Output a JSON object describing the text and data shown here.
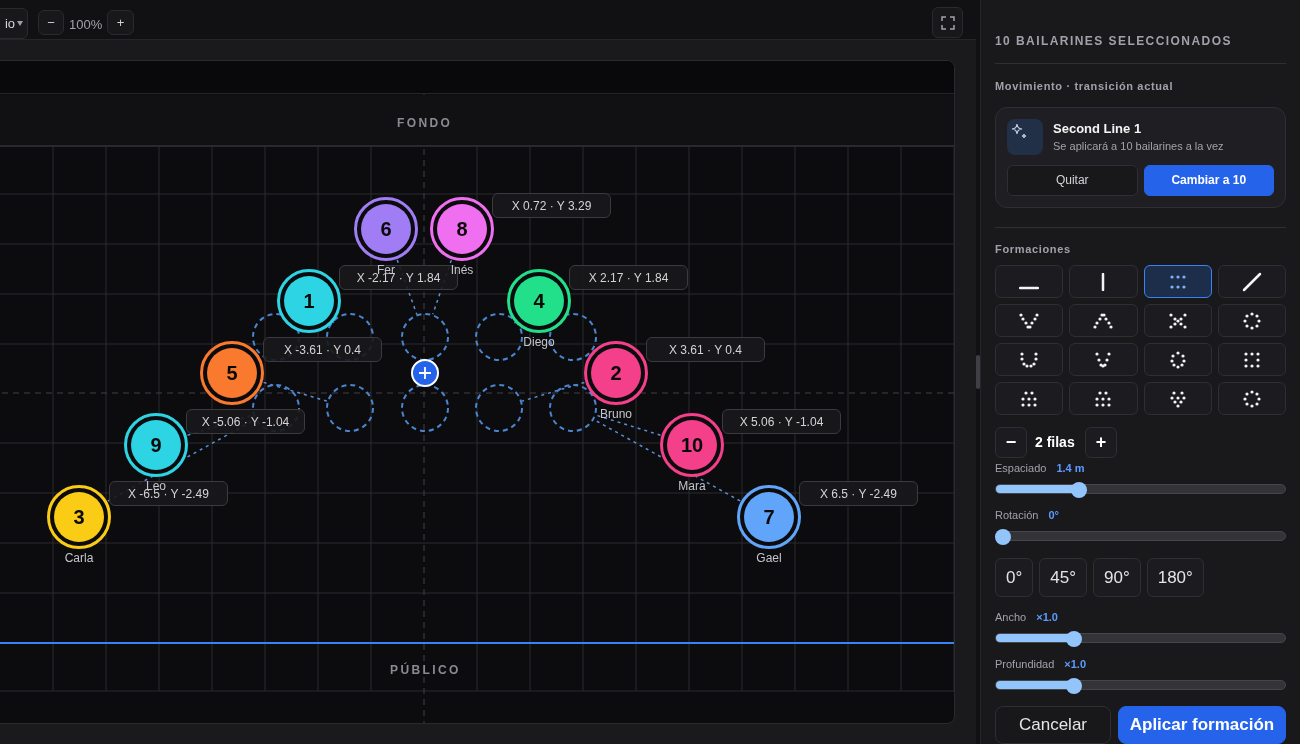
{
  "toolbar": {
    "view_select": "io",
    "zoom_out": "−",
    "zoom": "100%",
    "zoom_in": "+"
  },
  "stage": {
    "back_label": "FONDO",
    "front_label": "PÚBLICO",
    "dancers": [
      {
        "number": "6",
        "name": "Fer",
        "color": "#a07cf5"
      },
      {
        "number": "8",
        "name": "Inés",
        "color": "#f06ef0"
      },
      {
        "number": "1",
        "color": "#2dd4e4"
      },
      {
        "number": "4",
        "name": "Diego",
        "color": "#22e08a"
      },
      {
        "number": "5",
        "color": "#f97a2e"
      },
      {
        "number": "2",
        "name": "Bruno",
        "color": "#f43f8a"
      },
      {
        "number": "9",
        "name": "Leo",
        "color": "#2dd4e4"
      },
      {
        "number": "10",
        "name": "Mara",
        "color": "#f43f8a"
      },
      {
        "number": "3",
        "name": "Carla",
        "color": "#facc15"
      },
      {
        "number": "7",
        "name": "Gael",
        "color": "#60a5fa"
      }
    ],
    "coordinate_labels": [
      "X 0.72 · Y 3.29",
      "X -2.17 · Y 1.84",
      "X 2.17 · Y 1.84",
      "X -3.61 · Y 0.4",
      "X 3.61 · Y 0.4",
      "X -5.06 · Y -1.04",
      "X 5.06 · Y -1.04",
      "X -6.5 · Y -2.49",
      "X 6.5 · Y -2.49"
    ]
  },
  "panel": {
    "title": "10 BAILARINES SELECCIONADOS",
    "movement": {
      "heading": "Movimiento · transición actual",
      "name": "Second Line 1",
      "note": "Se aplicará a 10 bailarines a la vez",
      "buttons": [
        {
          "label": "Quitar",
          "kind": "secondary"
        },
        {
          "label": "Cambiar a 10",
          "kind": "primary"
        }
      ]
    },
    "formations": {
      "heading": "Formaciones",
      "items": [
        {
          "kind": "line-h",
          "selected": false
        },
        {
          "kind": "line-v",
          "selected": false
        },
        {
          "kind": "rows",
          "selected": true
        },
        {
          "kind": "diagonal",
          "selected": false
        },
        {
          "kind": "v",
          "selected": false
        },
        {
          "kind": "caret",
          "selected": false
        },
        {
          "kind": "x",
          "selected": false
        },
        {
          "kind": "circle",
          "selected": false
        },
        {
          "kind": "u",
          "selected": false
        },
        {
          "kind": "smile",
          "selected": false
        },
        {
          "kind": "ring",
          "selected": false
        },
        {
          "kind": "square",
          "selected": false
        },
        {
          "kind": "block",
          "selected": false
        },
        {
          "kind": "block",
          "selected": false
        },
        {
          "kind": "wedge",
          "selected": false
        },
        {
          "kind": "circle",
          "selected": false
        }
      ]
    },
    "rows": {
      "minus": "−",
      "label": "2 filas",
      "plus": "+"
    },
    "controls": [
      {
        "kind": "slider",
        "label": "Espaciado",
        "value": "1.4 m",
        "level": 0.29
      },
      {
        "kind": "slider",
        "label": "Rotación",
        "value": "0°",
        "level": 0
      },
      {
        "kind": "presets",
        "options": [
          "0°",
          "45°",
          "90°",
          "180°"
        ]
      },
      {
        "kind": "slider",
        "label": "Ancho",
        "value": "×1.0",
        "level": 0.27
      },
      {
        "kind": "slider",
        "label": "Profundidad",
        "value": "×1.0",
        "level": 0.27
      }
    ],
    "buttons": [
      {
        "label": "Cancelar",
        "kind": "secondary"
      },
      {
        "label": "Aplicar formación",
        "kind": "primary"
      }
    ]
  }
}
